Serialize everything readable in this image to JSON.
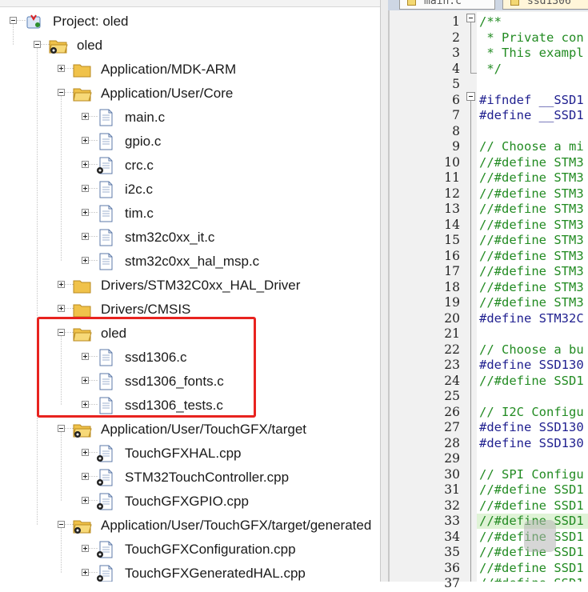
{
  "project_tree": {
    "rows": [
      {
        "label": "Project: oled",
        "indent": 0,
        "expander": "minus",
        "icon": "project-icon"
      },
      {
        "label": "oled",
        "indent": 1,
        "expander": "minus",
        "icon": "target-icon"
      },
      {
        "label": "Application/MDK-ARM",
        "indent": 2,
        "expander": "plus",
        "icon": "folder-icon"
      },
      {
        "label": "Application/User/Core",
        "indent": 2,
        "expander": "minus",
        "icon": "folder-open-icon"
      },
      {
        "label": "main.c",
        "indent": 3,
        "expander": "plus",
        "icon": "file-icon"
      },
      {
        "label": "gpio.c",
        "indent": 3,
        "expander": "plus",
        "icon": "file-icon"
      },
      {
        "label": "crc.c",
        "indent": 3,
        "expander": "plus",
        "icon": "file-gear-icon"
      },
      {
        "label": "i2c.c",
        "indent": 3,
        "expander": "plus",
        "icon": "file-icon"
      },
      {
        "label": "tim.c",
        "indent": 3,
        "expander": "plus",
        "icon": "file-icon"
      },
      {
        "label": "stm32c0xx_it.c",
        "indent": 3,
        "expander": "plus",
        "icon": "file-icon"
      },
      {
        "label": "stm32c0xx_hal_msp.c",
        "indent": 3,
        "expander": "plus",
        "icon": "file-icon"
      },
      {
        "label": "Drivers/STM32C0xx_HAL_Driver",
        "indent": 2,
        "expander": "plus",
        "icon": "folder-icon"
      },
      {
        "label": "Drivers/CMSIS",
        "indent": 2,
        "expander": "plus",
        "icon": "folder-icon"
      },
      {
        "label": "oled",
        "indent": 2,
        "expander": "minus",
        "icon": "folder-open-icon"
      },
      {
        "label": "ssd1306.c",
        "indent": 3,
        "expander": "plus",
        "icon": "file-icon"
      },
      {
        "label": "ssd1306_fonts.c",
        "indent": 3,
        "expander": "plus",
        "icon": "file-icon"
      },
      {
        "label": "ssd1306_tests.c",
        "indent": 3,
        "expander": "plus",
        "icon": "file-icon"
      },
      {
        "label": "Application/User/TouchGFX/target",
        "indent": 2,
        "expander": "minus",
        "icon": "folder-gear-open-icon"
      },
      {
        "label": "TouchGFXHAL.cpp",
        "indent": 3,
        "expander": "plus",
        "icon": "file-gear-icon"
      },
      {
        "label": "STM32TouchController.cpp",
        "indent": 3,
        "expander": "plus",
        "icon": "file-gear-icon"
      },
      {
        "label": "TouchGFXGPIO.cpp",
        "indent": 3,
        "expander": "plus",
        "icon": "file-gear-icon"
      },
      {
        "label": "Application/User/TouchGFX/target/generated",
        "indent": 2,
        "expander": "minus",
        "icon": "folder-gear-open-icon"
      },
      {
        "label": "TouchGFXConfiguration.cpp",
        "indent": 3,
        "expander": "plus",
        "icon": "file-gear-icon"
      },
      {
        "label": "TouchGFXGeneratedHAL.cpp",
        "indent": 3,
        "expander": "plus",
        "icon": "file-gear-icon"
      }
    ]
  },
  "editor": {
    "tabs": [
      {
        "label": "main.c"
      },
      {
        "label": "ssd1306"
      }
    ],
    "lines": [
      {
        "n": "1",
        "text": "/**",
        "cls": "c-comment",
        "fold": "open"
      },
      {
        "n": "2",
        "text": " * Private con",
        "cls": "c-comment"
      },
      {
        "n": "3",
        "text": " * This exampl",
        "cls": "c-comment"
      },
      {
        "n": "4",
        "text": " */",
        "cls": "c-comment",
        "fold": "end"
      },
      {
        "n": "5",
        "text": "",
        "cls": "c-norm"
      },
      {
        "n": "6",
        "text": "#ifndef __SSD1",
        "cls": "c-pre",
        "fold": "open"
      },
      {
        "n": "7",
        "text": "#define __SSD1",
        "cls": "c-pre"
      },
      {
        "n": "8",
        "text": "",
        "cls": "c-norm"
      },
      {
        "n": "9",
        "text": "// Choose a mi",
        "cls": "c-comment"
      },
      {
        "n": "10",
        "text": "//#define STM3",
        "cls": "c-comment"
      },
      {
        "n": "11",
        "text": "//#define STM3",
        "cls": "c-comment"
      },
      {
        "n": "12",
        "text": "//#define STM3",
        "cls": "c-comment"
      },
      {
        "n": "13",
        "text": "//#define STM3",
        "cls": "c-comment"
      },
      {
        "n": "14",
        "text": "//#define STM3",
        "cls": "c-comment"
      },
      {
        "n": "15",
        "text": "//#define STM3",
        "cls": "c-comment"
      },
      {
        "n": "16",
        "text": "//#define STM3",
        "cls": "c-comment"
      },
      {
        "n": "17",
        "text": "//#define STM3",
        "cls": "c-comment"
      },
      {
        "n": "18",
        "text": "//#define STM3",
        "cls": "c-comment"
      },
      {
        "n": "19",
        "text": "//#define STM3",
        "cls": "c-comment"
      },
      {
        "n": "20",
        "text": "#define STM32C",
        "cls": "c-pre"
      },
      {
        "n": "21",
        "text": "",
        "cls": "c-norm"
      },
      {
        "n": "22",
        "text": "// Choose a bu",
        "cls": "c-comment"
      },
      {
        "n": "23",
        "text": "#define SSD130",
        "cls": "c-pre"
      },
      {
        "n": "24",
        "text": "//#define SSD1",
        "cls": "c-comment"
      },
      {
        "n": "25",
        "text": "",
        "cls": "c-norm"
      },
      {
        "n": "26",
        "text": "// I2C Configu",
        "cls": "c-comment"
      },
      {
        "n": "27",
        "text": "#define SSD130",
        "cls": "c-pre"
      },
      {
        "n": "28",
        "text": "#define SSD130",
        "cls": "c-pre"
      },
      {
        "n": "29",
        "text": "",
        "cls": "c-norm"
      },
      {
        "n": "30",
        "text": "// SPI Configu",
        "cls": "c-comment"
      },
      {
        "n": "31",
        "text": "//#define SSD1",
        "cls": "c-comment"
      },
      {
        "n": "32",
        "text": "//#define SSD1",
        "cls": "c-comment"
      },
      {
        "n": "33",
        "text": "//#define SSD1",
        "cls": "c-comment",
        "highlight": true
      },
      {
        "n": "34",
        "text": "//#define SSD1",
        "cls": "c-comment"
      },
      {
        "n": "35",
        "text": "//#define SSD1",
        "cls": "c-comment"
      },
      {
        "n": "36",
        "text": "//#define SSD1",
        "cls": "c-comment"
      },
      {
        "n": "37",
        "text": "//#define SSD1",
        "cls": "c-comment"
      }
    ]
  },
  "colors": {
    "highlight_box": "#e8231f",
    "comment": "#228b22",
    "preprocessor": "#1f1f8f"
  }
}
